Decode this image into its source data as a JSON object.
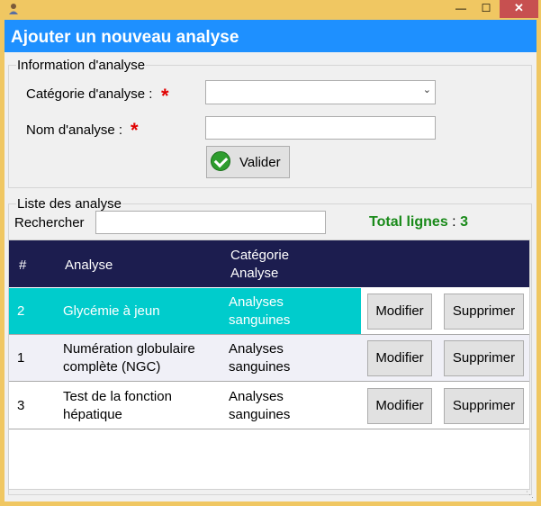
{
  "window": {
    "min_glyph": "—",
    "max_glyph": "☐",
    "close_glyph": "✕"
  },
  "header": {
    "title": "Ajouter un nouveau analyse"
  },
  "form": {
    "legend": "Information d'analyse",
    "category_label": "Catégorie d'analyse :",
    "category_value": "",
    "name_label": "Nom d'analyse :",
    "name_value": "",
    "required_mark": "*",
    "validate_label": "Valider"
  },
  "list": {
    "legend": "Liste des analyse",
    "search_label": "Rechercher",
    "search_value": "",
    "total_label": "Total lignes",
    "total_sep": ":",
    "total_value": "3",
    "columns": {
      "num": "#",
      "analysis": "Analyse",
      "category_line1": "Catégorie",
      "category_line2": "Analyse"
    },
    "rows": [
      {
        "num": "2",
        "name_l1": "Glycémie à jeun",
        "name_l2": "",
        "cat_l1": "Analyses",
        "cat_l2": "sanguines",
        "selected": true
      },
      {
        "num": "1",
        "name_l1": "Numération globulaire",
        "name_l2": "complète (NGC)",
        "cat_l1": "Analyses",
        "cat_l2": "sanguines",
        "selected": false
      },
      {
        "num": "3",
        "name_l1": "Test de la fonction",
        "name_l2": "hépatique",
        "cat_l1": "Analyses",
        "cat_l2": "sanguines",
        "selected": false
      }
    ],
    "modify_label": "Modifier",
    "delete_label": "Supprimer"
  },
  "colors": {
    "header": "#1e90ff",
    "grid_header": "#1c1d4f",
    "selected_row": "#00cccc",
    "total": "#1a8a1a",
    "required": "#e00000",
    "frame": "#f0c762"
  },
  "icons": {
    "app": "user-icon",
    "validate": "check-icon",
    "dropdown": "chevron-down-icon"
  }
}
